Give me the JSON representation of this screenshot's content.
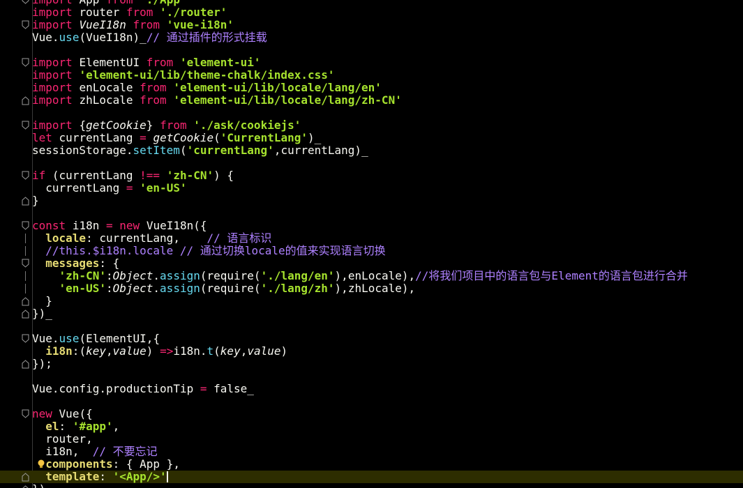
{
  "editor": {
    "lines": [
      "import App from './App'",
      "import router from './router'",
      "import VueI18n from 'vue-i18n'",
      "Vue.use(VueI18n)_// 通过插件的形式挂载",
      "",
      "import ElementUI from 'element-ui'",
      "import 'element-ui/lib/theme-chalk/index.css'",
      "import enLocale from 'element-ui/lib/locale/lang/en'",
      "import zhLocale from 'element-ui/lib/locale/lang/zh-CN'",
      "",
      "import {getCookie} from './ask/cookiejs'",
      "let currentLang = getCookie('CurrentLang')_",
      "sessionStorage.setItem('currentLang',currentLang)_",
      "",
      "if (currentLang !== 'zh-CN') {",
      "  currentLang = 'en-US'",
      "}",
      "",
      "const i18n = new VueI18n({",
      "  locale: currentLang,    // 语言标识",
      "  //this.$i18n.locale // 通过切换locale的值来实现语言切换",
      "  messages: {",
      "    'zh-CN':Object.assign(require('./lang/en'),enLocale),//将我们项目中的语言包与Element的语言包进行合并",
      "    'en-US':Object.assign(require('./lang/zh'),zhLocale),",
      "  }",
      "})_",
      "",
      "Vue.use(ElementUI,{",
      "  i18n:(key,value) =>i18n.t(key,value)",
      "});",
      "",
      "Vue.config.productionTip = false_",
      "",
      "new Vue({",
      "  el: '#app',",
      "  router,",
      "  i18n,  // 不要忘记",
      "  components: { App },",
      "  template: '<App/>'",
      "})"
    ]
  },
  "colors": {
    "background": "#000000",
    "keyword": "#f92672",
    "string": "#a6e22e",
    "comment": "#ae81ff",
    "property": "#e6db74",
    "variable": "#66d9ef",
    "active_line": "#2d2d00"
  },
  "icons": {
    "fold": "fold-marker-icon",
    "hint": "lightbulb-icon"
  }
}
